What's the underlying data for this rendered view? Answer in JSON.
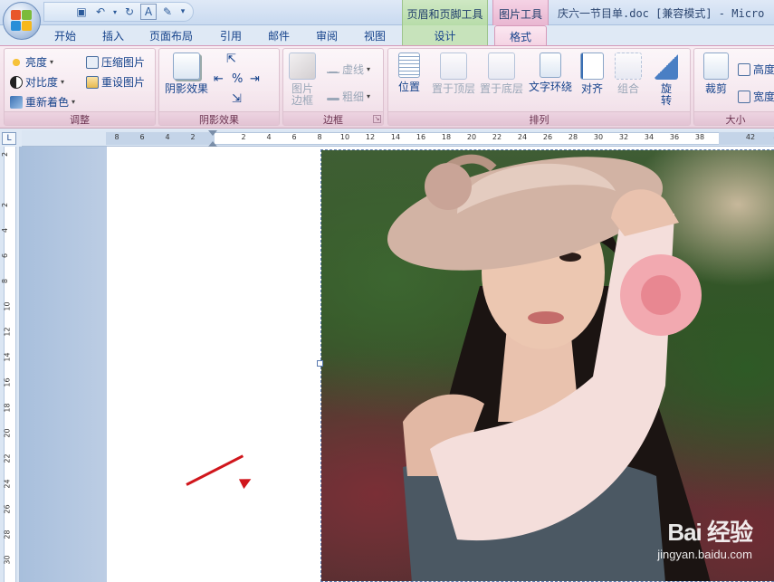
{
  "window": {
    "title": "庆六一节目单.doc [兼容模式] - Micro",
    "context_tab_header_footer": "页眉和页脚工具",
    "context_tab_picture": "图片工具"
  },
  "tabs": [
    "开始",
    "插入",
    "页面布局",
    "引用",
    "邮件",
    "审阅",
    "视图"
  ],
  "context_subtab_design": "设计",
  "active_tab": "格式",
  "ribbon": {
    "adjust": {
      "label": "调整",
      "brightness": "亮度",
      "contrast": "对比度",
      "recolor": "重新着色",
      "compress": "压缩图片",
      "reset": "重设图片"
    },
    "shadow": {
      "label": "阴影效果",
      "shadow_effects": "阴影效果"
    },
    "border": {
      "label": "边框",
      "picture_border_line1": "图片",
      "picture_border_line2": "边框",
      "dashes": "虚线",
      "weight": "粗细"
    },
    "arrange": {
      "label": "排列",
      "position": "位置",
      "bring_front": "置于顶层",
      "send_back": "置于底层",
      "text_wrap": "文字环绕",
      "align": "对齐",
      "group": "组合",
      "rotate_line1": "旋",
      "rotate_line2": "转"
    },
    "size": {
      "label": "大小",
      "crop": "裁剪",
      "height": "高度",
      "width": "宽度"
    }
  },
  "ruler": {
    "corner": "L",
    "h_ticks": [
      "8",
      "6",
      "4",
      "2",
      "",
      "2",
      "4",
      "6",
      "8",
      "10",
      "12",
      "14",
      "16",
      "18",
      "20",
      "22",
      "24",
      "26",
      "28",
      "30",
      "32",
      "34",
      "36",
      "38",
      "",
      "42",
      "4"
    ],
    "v_ticks": [
      "2",
      "",
      "2",
      "4",
      "6",
      "8",
      "10",
      "12",
      "14",
      "16",
      "18",
      "20",
      "22",
      "24",
      "26",
      "28",
      "30"
    ]
  },
  "watermark": {
    "logo": "Bai 经验",
    "url": "jingyan.baidu.com"
  },
  "colors": {
    "accent_pink": "#f4d3e3",
    "accent_green": "#c7e3bb",
    "arrow_red": "#d0161c"
  }
}
